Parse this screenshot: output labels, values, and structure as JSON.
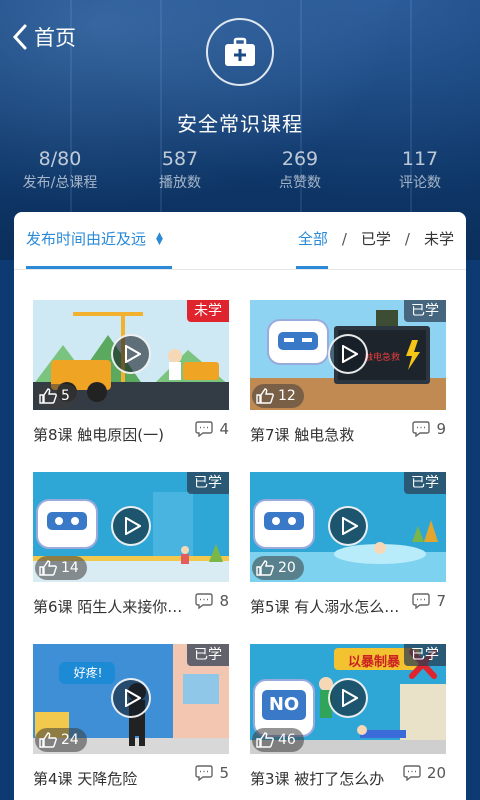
{
  "header": {
    "back_label": "首页",
    "title": "安全常识课程"
  },
  "stats": [
    {
      "value": "8/80",
      "label": "发布/总课程"
    },
    {
      "value": "587",
      "label": "播放数"
    },
    {
      "value": "269",
      "label": "点赞数"
    },
    {
      "value": "117",
      "label": "评论数"
    }
  ],
  "toolbar": {
    "sort_label": "发布时间由近及远",
    "filters": [
      "全部",
      "已学",
      "未学"
    ],
    "active_filter": "全部"
  },
  "courses": [
    {
      "title": "第8课  触电原因(一)",
      "status": "未学",
      "likes": "5",
      "comments": "4",
      "caption": ""
    },
    {
      "title": "第7课  触电急救",
      "status": "已学",
      "likes": "12",
      "comments": "9",
      "caption": "触电急救"
    },
    {
      "title": "第6课  陌生人来接你…",
      "status": "已学",
      "likes": "14",
      "comments": "8",
      "caption": ""
    },
    {
      "title": "第5课  有人溺水怎么…",
      "status": "已学",
      "likes": "20",
      "comments": "7",
      "caption": ""
    },
    {
      "title": "第4课  天降危险",
      "status": "已学",
      "likes": "24",
      "comments": "5",
      "caption": "好疼!"
    },
    {
      "title": "第3课  被打了怎么办",
      "status": "已学",
      "likes": "46",
      "comments": "20",
      "caption": "以暴制暴",
      "sign_text": "NO"
    }
  ],
  "colors": {
    "accent": "#2a8ad8",
    "badge_new": "#e0242d",
    "badge_done": "#3c5064",
    "hero": "#0f3a6e"
  }
}
